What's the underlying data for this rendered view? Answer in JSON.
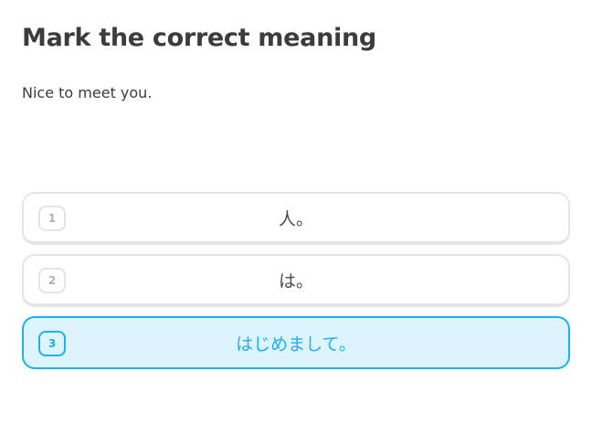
{
  "challenge": {
    "title": "Mark the correct meaning",
    "prompt": "Nice to meet you."
  },
  "choices": [
    {
      "number": "1",
      "text": "人。",
      "selected": false
    },
    {
      "number": "2",
      "text": "は。",
      "selected": false
    },
    {
      "number": "3",
      "text": "はじめまして。",
      "selected": true
    }
  ],
  "colors": {
    "text": "#3c3c3c",
    "border": "#e5e5e5",
    "selected_accent": "#1cb0f6",
    "selected_background": "#ddf4ff"
  }
}
